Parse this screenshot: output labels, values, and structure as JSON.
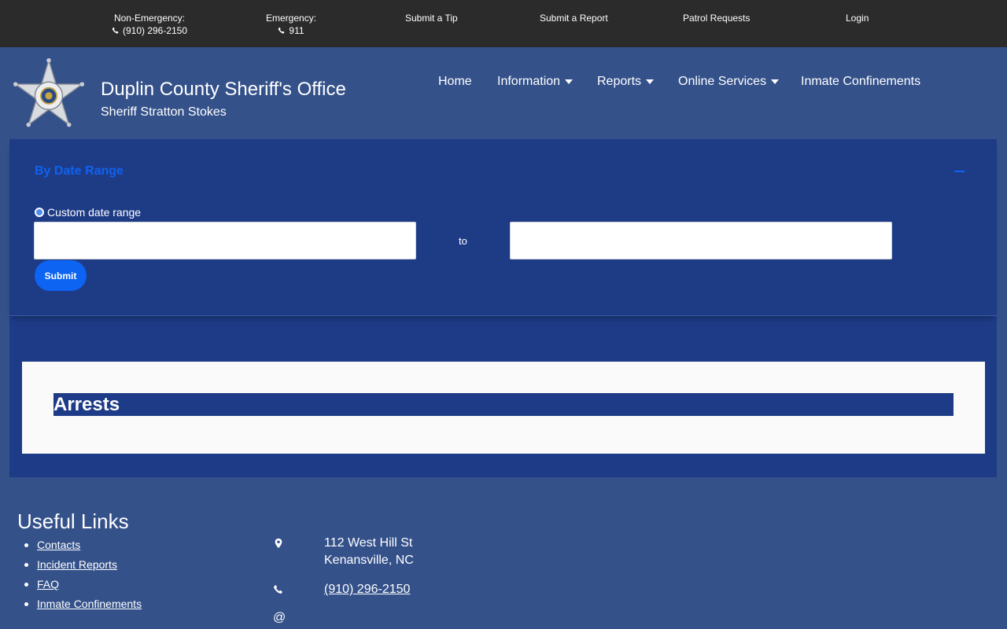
{
  "topbar": {
    "non_emergency_label": "Non-Emergency:",
    "non_emergency_phone": "(910) 296-2150",
    "emergency_label": "Emergency:",
    "emergency_phone": "911",
    "submit_tip": "Submit a Tip",
    "submit_report": "Submit a Report",
    "patrol_requests": "Patrol Requests",
    "login": "Login"
  },
  "header": {
    "title": "Duplin County Sheriff's Office",
    "subtitle": "Sheriff Stratton Stokes",
    "nav": {
      "home": "Home",
      "information": "Information",
      "reports": "Reports",
      "online_services": "Online Services",
      "inmate_confinements": "Inmate Confinements"
    }
  },
  "filter": {
    "title": "By Date Range",
    "radio_label": "Custom date range",
    "start_value": "",
    "to_label": "to",
    "end_value": "",
    "submit_label": "Submit"
  },
  "results": {
    "title": "Arrests"
  },
  "footer": {
    "heading": "Useful Links",
    "links": [
      "Contacts",
      "Incident Reports",
      "FAQ",
      "Inmate Confinements"
    ],
    "address_line1": "112 West Hill St",
    "address_line2": "Kenansville, NC",
    "phone": "(910) 296-2150",
    "email_icon_glyph": "@"
  },
  "colors": {
    "topbar_bg": "#2b2b2b",
    "header_bg": "#34518a",
    "main_bg": "#1e3b87",
    "accent": "#0d64f3"
  },
  "icons": [
    "phone-icon",
    "sheriff-star-badge",
    "caret-down-icon",
    "minus-icon",
    "map-pin-icon",
    "at-icon"
  ]
}
